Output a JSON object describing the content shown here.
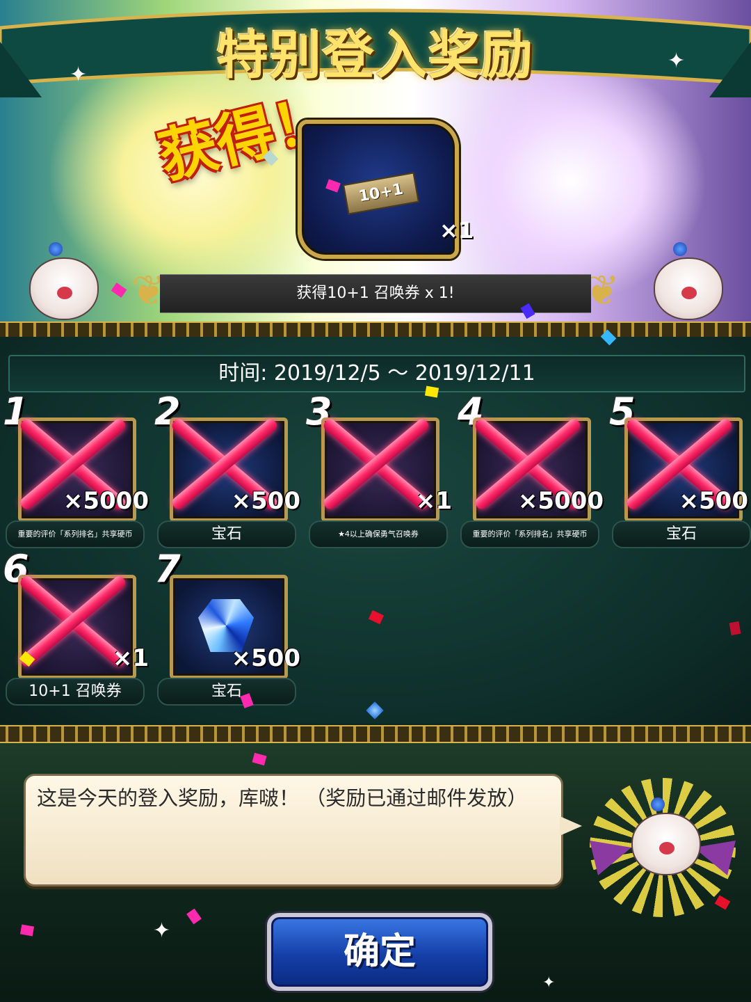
{
  "banner": {
    "title": "特别登入奖励",
    "obtained_label": "获得！",
    "reward_ticket_label": "10+1",
    "reward_count": "×1",
    "message": "获得10+1 召唤券 x 1!"
  },
  "panel": {
    "date_range": "时间:  2019/12/5 ～ 2019/12/11",
    "days": [
      {
        "day": "1",
        "qty": "×5000",
        "name": "重要的评价「系列排名」共享硬币",
        "claimed": true
      },
      {
        "day": "2",
        "qty": "×500",
        "name": "宝石",
        "claimed": true
      },
      {
        "day": "3",
        "qty": "×1",
        "name": "★4以上确保勇气召唤券",
        "claimed": true
      },
      {
        "day": "4",
        "qty": "×5000",
        "name": "重要的评价「系列排名」共享硬币",
        "claimed": true
      },
      {
        "day": "5",
        "qty": "×500",
        "name": "宝石",
        "claimed": true
      },
      {
        "day": "6",
        "qty": "×1",
        "name": "10+1 召唤券",
        "claimed": true
      },
      {
        "day": "7",
        "qty": "×500",
        "name": "宝石",
        "claimed": false
      }
    ]
  },
  "dialog": {
    "text": "这是今天的登入奖励，库啵！ （奖励已通过邮件发放）"
  },
  "confirm_button": {
    "label": "确定"
  },
  "colors": {
    "accent_gold": "#d8b24a",
    "claimed_cross": "#ff2a6a",
    "button_blue": "#143fa8",
    "panel_green": "#19463e"
  },
  "icons": [
    "moogle-mascot",
    "ornament-scroll",
    "blue-gem",
    "summon-ticket",
    "sparkle",
    "confetti"
  ]
}
